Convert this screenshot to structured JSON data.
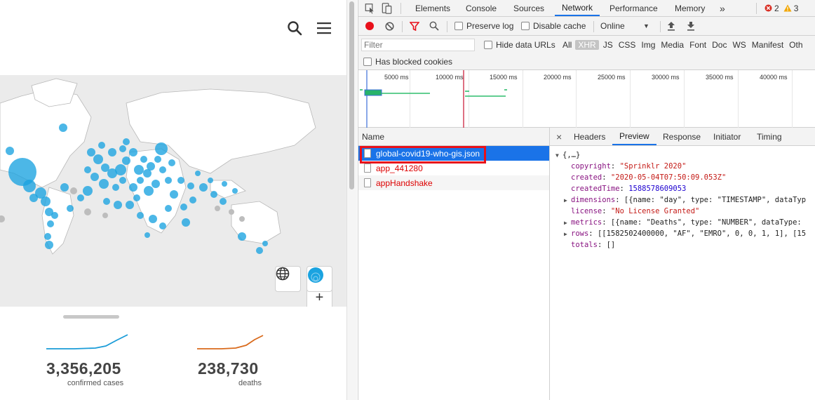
{
  "page": {
    "stats": [
      {
        "value": "3,356,205",
        "label": "confirmed cases",
        "color": "#1a9cd8"
      },
      {
        "value": "238,730",
        "label": "deaths",
        "color": "#d96a1c"
      }
    ],
    "map": {
      "zoom_in": "+",
      "zoom_out": "−",
      "circle_color": "#1aa3e0"
    }
  },
  "devtools": {
    "tabs": [
      "Elements",
      "Console",
      "Sources",
      "Network",
      "Performance",
      "Memory"
    ],
    "active_tab": "Network",
    "more_tabs": "»",
    "errors": "2",
    "warnings": "3",
    "toolbar": {
      "preserve_log": "Preserve log",
      "disable_cache": "Disable cache",
      "throttle": "Online"
    },
    "filter": {
      "placeholder": "Filter",
      "hide_data_urls": "Hide data URLs",
      "types": [
        "All",
        "XHR",
        "JS",
        "CSS",
        "Img",
        "Media",
        "Font",
        "Doc",
        "WS",
        "Manifest",
        "Oth"
      ],
      "active_type": "XHR",
      "blocked_cookies": "Has blocked cookies"
    },
    "timeline_ticks": [
      "5000 ms",
      "10000 ms",
      "15000 ms",
      "20000 ms",
      "25000 ms",
      "30000 ms",
      "35000 ms",
      "40000 ms"
    ],
    "requests": {
      "header": "Name",
      "items": [
        {
          "name": "global-covid19-who-gis.json",
          "selected": true
        },
        {
          "name": "app_441280",
          "selected": false
        },
        {
          "name": "appHandshake",
          "selected": false
        }
      ]
    },
    "detail_tabs": [
      "Headers",
      "Preview",
      "Response",
      "Initiator",
      "Timing"
    ],
    "active_detail_tab": "Preview",
    "close": "×",
    "preview": {
      "root": "{,…}",
      "copyright_key": "copyright",
      "copyright_val": "\"Sprinklr 2020\"",
      "created_key": "created",
      "created_val": "\"2020-05-04T07:50:09.053Z\"",
      "createdTime_key": "createdTime",
      "createdTime_val": "1588578609053",
      "dimensions_key": "dimensions",
      "dimensions_val": "[{name: \"day\", type: \"TIMESTAMP\", dataTyp",
      "license_key": "license",
      "license_val": "\"No License Granted\"",
      "metrics_key": "metrics",
      "metrics_val": "[{name: \"Deaths\", type: \"NUMBER\", dataType:",
      "rows_key": "rows",
      "rows_val": "[[1582502400000, \"AF\", \"EMRO\", 0, 0, 1, 1], [15",
      "totals_key": "totals",
      "totals_val": "[]"
    }
  }
}
